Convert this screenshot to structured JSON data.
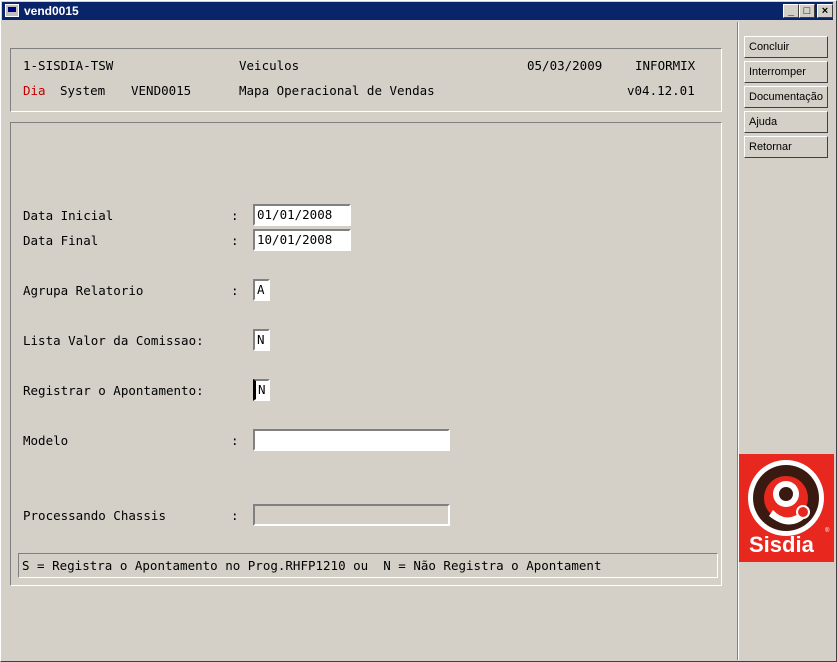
{
  "window": {
    "title": "vend0015"
  },
  "titlebar_buttons": {
    "minimize": "_",
    "maximize": "□",
    "close": "×"
  },
  "header": {
    "line1": {
      "company": "1-SISDIA-TSW",
      "module": "Veiculos",
      "date": "05/03/2009",
      "db": "INFORMIX"
    },
    "line2": {
      "dia": "Dia",
      "system": "System",
      "program": "VEND0015",
      "description": "Mapa Operacional de Vendas",
      "version": "v04.12.01"
    }
  },
  "form": {
    "data_inicial": {
      "label": "Data Inicial",
      "sep": ":",
      "value": "01/01/2008"
    },
    "data_final": {
      "label": "Data Final",
      "sep": ":",
      "value": "10/01/2008"
    },
    "agrupa": {
      "label": "Agrupa Relatorio",
      "sep": ":",
      "value": "A"
    },
    "lista": {
      "label": "Lista Valor da Comissao:",
      "value": "N"
    },
    "registrar": {
      "label": "Registrar o Apontamento:",
      "value": "N"
    },
    "modelo": {
      "label": "Modelo",
      "sep": ":",
      "value": ""
    },
    "processando": {
      "label": "Processando Chassis",
      "sep": ":",
      "value": ""
    }
  },
  "hint": "S = Registra o Apontamento no Prog.RHFP1210 ou  N = Não Registra o Apontament",
  "side_buttons": [
    "Concluir",
    "Interromper",
    "Documentação",
    "Ajuda",
    "Retornar"
  ],
  "logo": {
    "text": "Sisdia",
    "colors": {
      "bg": "#e8281e",
      "dark": "#3a1a10"
    }
  }
}
